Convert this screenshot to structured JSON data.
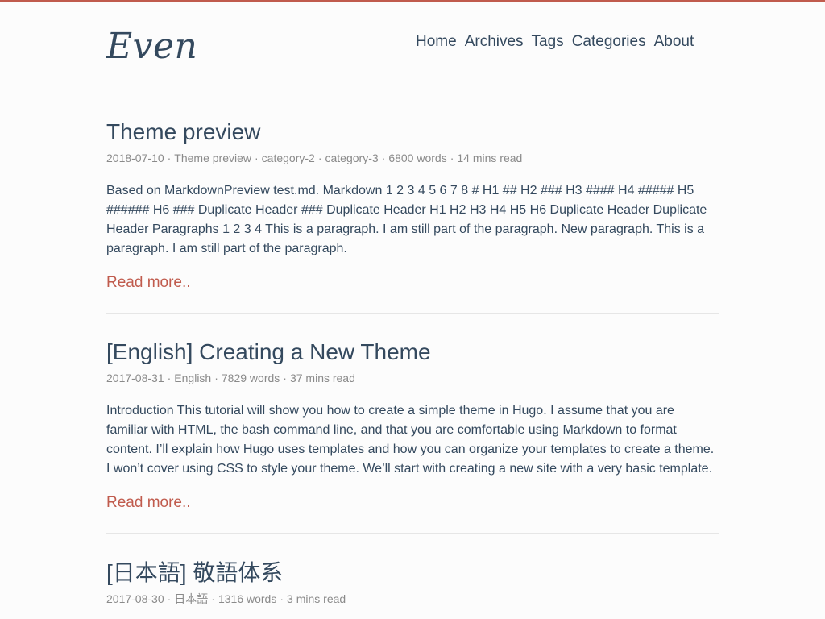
{
  "site": {
    "logo": "Even",
    "accent_color": "#c05b4d",
    "text_color": "#34495e"
  },
  "nav": {
    "items": [
      "Home",
      "Archives",
      "Tags",
      "Categories",
      "About"
    ]
  },
  "posts": [
    {
      "title": "Theme preview",
      "date": "2018-07-10",
      "categories": [
        "Theme preview",
        "category-2",
        "category-3"
      ],
      "words": "6800 words",
      "read_time": "14 mins read",
      "summary": "Based on MarkdownPreview test.md. Markdown 1 2 3 4 5 6 7 8 # H1 ## H2 ### H3 #### H4 ##### H5 ###### H6 ### Duplicate Header ### Duplicate Header H1 H2 H3 H4 H5 H6 Duplicate Header Duplicate Header Paragraphs 1 2 3 4 This is a paragraph. I am still part of the paragraph. New paragraph. This is a paragraph. I am still part of the paragraph.",
      "read_more": "Read more.."
    },
    {
      "title": "[English] Creating a New Theme",
      "date": "2017-08-31",
      "categories": [
        "English"
      ],
      "words": "7829 words",
      "read_time": "37 mins read",
      "summary": "Introduction This tutorial will show you how to create a simple theme in Hugo. I assume that you are familiar with HTML, the bash command line, and that you are comfortable using Markdown to format content. I’ll explain how Hugo uses templates and how you can organize your templates to create a theme. I won’t cover using CSS to style your theme. We’ll start with creating a new site with a very basic template.",
      "read_more": "Read more.."
    },
    {
      "title": "[日本語] 敬語体系",
      "date": "2017-08-30",
      "categories": [
        "日本語"
      ],
      "words": "1316 words",
      "read_time": "3 mins read"
    }
  ],
  "meta_separator": "·"
}
